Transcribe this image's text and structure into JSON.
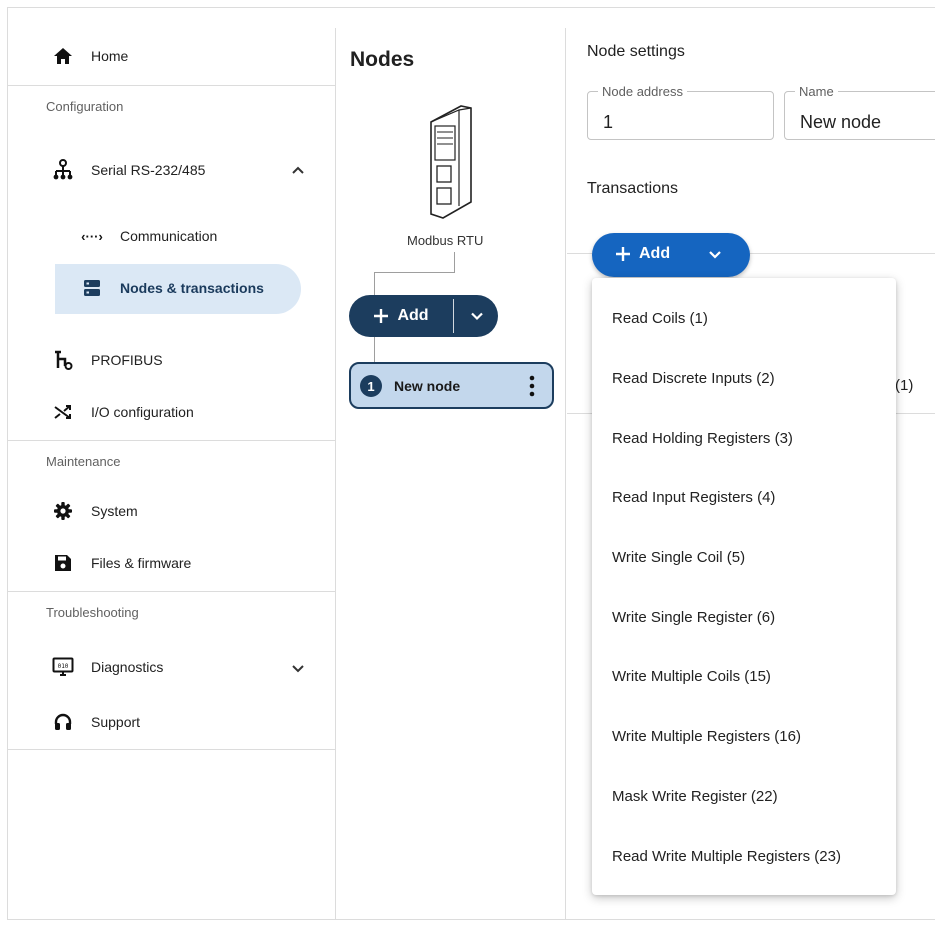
{
  "sidebar": {
    "home": "Home",
    "sections": {
      "configuration": "Configuration",
      "maintenance": "Maintenance",
      "troubleshooting": "Troubleshooting"
    },
    "serial": "Serial RS-232/485",
    "communication": "Communication",
    "nodes_transactions": "Nodes & transactions",
    "profibus": "PROFIBUS",
    "io_configuration": "I/O configuration",
    "system": "System",
    "files_firmware": "Files & firmware",
    "diagnostics": "Diagnostics",
    "support": "Support"
  },
  "nodes": {
    "title": "Nodes",
    "device_label": "Modbus RTU",
    "add_label": "Add",
    "node": {
      "number": "1",
      "name": "New node"
    }
  },
  "settings": {
    "title": "Node settings",
    "address": {
      "label": "Node address",
      "value": "1"
    },
    "name": {
      "label": "Name",
      "value": "New node"
    },
    "transactions_title": "Transactions",
    "add_label": "Add",
    "row_hint": "(1)"
  },
  "menu": {
    "items": [
      "Read Coils (1)",
      "Read Discrete Inputs (2)",
      "Read Holding Registers (3)",
      "Read Input Registers (4)",
      "Write Single Coil (5)",
      "Write Single Register (6)",
      "Write Multiple Coils (15)",
      "Write Multiple Registers (16)",
      "Mask Write Register (22)",
      "Read Write Multiple Registers (23)"
    ]
  },
  "colors": {
    "primary_dark": "#1c3d5e",
    "primary": "#1565c0",
    "active_bg": "#dbe8f5",
    "node_bg": "#c3d7ec"
  }
}
